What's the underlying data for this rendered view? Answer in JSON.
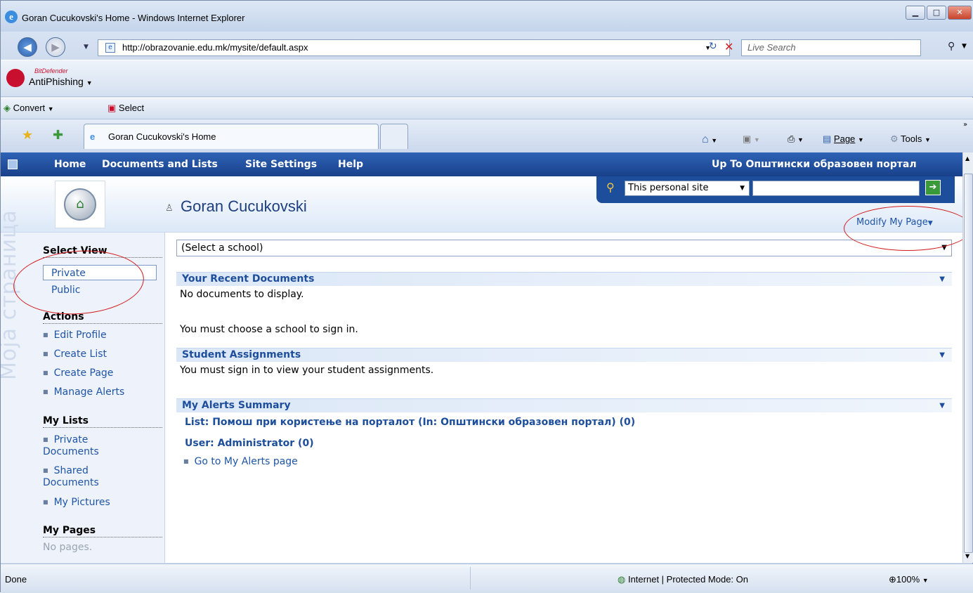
{
  "window": {
    "title": "Goran Cucukovski's Home - Windows Internet Explorer"
  },
  "address": {
    "url": "http://obrazovanie.edu.mk/mysite/default.aspx",
    "search_placeholder": "Live Search"
  },
  "toolbar_bitdefender": {
    "brand": "BitDefender",
    "name": "AntiPhishing"
  },
  "toolbar_convert": {
    "convert_label": "Convert",
    "select_label": "Select"
  },
  "tabs": {
    "active_tab": "Goran Cucukovski's Home"
  },
  "commandbar": {
    "page_label": "Page",
    "tools_label": "Tools"
  },
  "topnav": {
    "items": [
      "Home",
      "Documents and Lists",
      "Site Settings",
      "Help"
    ],
    "up_link": "Up To Општински образовен портал"
  },
  "header": {
    "user_name": "Goran Cucukovski",
    "search_scope": "This personal site",
    "modify_label": "Modify My Page"
  },
  "sidebar": {
    "watermark": "Моја страница",
    "select_view": {
      "title": "Select View",
      "items": [
        "Private",
        "Public"
      ]
    },
    "actions": {
      "title": "Actions",
      "items": [
        "Edit Profile",
        "Create List",
        "Create Page",
        "Manage Alerts"
      ]
    },
    "my_lists": {
      "title": "My Lists",
      "items": [
        "Private Documents",
        "Shared Documents",
        "My Pictures"
      ]
    },
    "my_pages": {
      "title": "My Pages",
      "empty": "No pages."
    }
  },
  "main": {
    "school_select": "(Select a school)",
    "recent_docs": {
      "title": "Your Recent Documents",
      "line1": "No documents to display.",
      "line2": "You must choose a school to sign in."
    },
    "student_assignments": {
      "title": "Student Assignments",
      "line1": "You must sign in to view your student assignments."
    },
    "alerts": {
      "title": "My Alerts Summary",
      "list_alert": "List: Помош при користење на порталот (In: Општински образовен портал) (0)",
      "user_alert": "User: Administrator (0)",
      "go_link": "Go to My Alerts page"
    }
  },
  "status": {
    "left": "Done",
    "zone": "Internet | Protected Mode: On",
    "zoom": "100%"
  }
}
